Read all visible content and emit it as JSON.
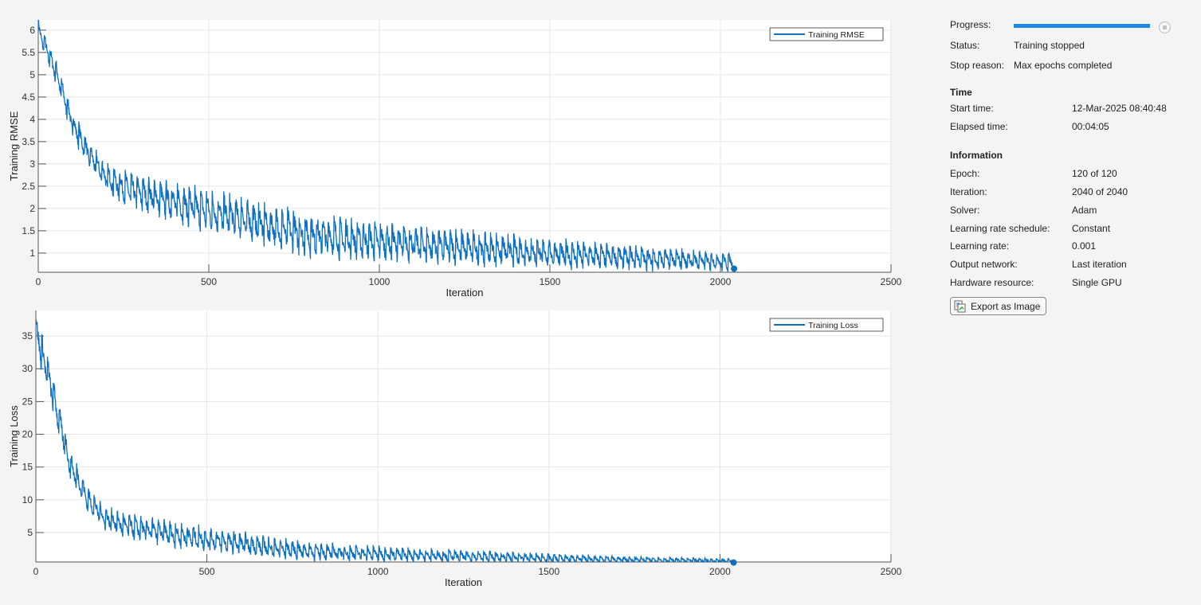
{
  "chart_data": [
    {
      "type": "line",
      "title": "",
      "xlabel": "Iteration",
      "ylabel": "Training RMSE",
      "xlim": [
        0,
        2500
      ],
      "ylim": [
        0.57,
        6.23
      ],
      "xticks": [
        0,
        500,
        1000,
        1500,
        2000,
        2500
      ],
      "yticks": [
        1,
        1.5,
        2,
        2.5,
        3,
        3.5,
        4,
        4.5,
        5,
        5.5,
        6
      ],
      "grid": true,
      "legend": {
        "position": "top-right",
        "entries": [
          "Training RMSE"
        ]
      },
      "iterations_per_epoch": 17,
      "series": [
        {
          "name": "Training RMSE",
          "color": "#0f6fc0",
          "x": [
            0,
            50,
            100,
            150,
            200,
            250,
            300,
            400,
            500,
            600,
            700,
            800,
            900,
            1000,
            1200,
            1400,
            1600,
            1800,
            2040
          ],
          "upper": [
            6.25,
            5.4,
            4.2,
            3.5,
            3.0,
            2.85,
            2.75,
            2.6,
            2.4,
            2.25,
            2.05,
            1.9,
            1.8,
            1.7,
            1.55,
            1.4,
            1.25,
            1.15,
            1.0
          ],
          "lower": [
            5.8,
            4.9,
            3.7,
            2.95,
            2.45,
            2.2,
            2.05,
            1.8,
            1.6,
            1.4,
            1.2,
            1.05,
            0.98,
            0.95,
            0.85,
            0.78,
            0.72,
            0.68,
            0.65
          ],
          "final": [
            2040,
            0.65
          ]
        }
      ]
    },
    {
      "type": "line",
      "title": "",
      "xlabel": "Iteration",
      "ylabel": "Training Loss",
      "xlim": [
        0,
        2500
      ],
      "ylim": [
        0.5,
        38.9
      ],
      "xticks": [
        0,
        500,
        1000,
        1500,
        2000,
        2500
      ],
      "yticks": [
        5,
        10,
        15,
        20,
        25,
        30,
        35
      ],
      "grid": true,
      "legend": {
        "position": "top-right",
        "entries": [
          "Training Loss"
        ]
      },
      "iterations_per_epoch": 17,
      "series": [
        {
          "name": "Training Loss",
          "color": "#0f6fc0",
          "x": [
            0,
            50,
            100,
            150,
            200,
            250,
            300,
            400,
            500,
            600,
            700,
            800,
            900,
            1000,
            1200,
            1400,
            1600,
            1800,
            2040
          ],
          "upper": [
            39,
            29,
            17.6,
            12.2,
            9,
            8.1,
            7.6,
            6.8,
            5.8,
            5.1,
            4.2,
            3.6,
            3.2,
            2.9,
            2.4,
            2.0,
            1.6,
            1.3,
            1.0
          ],
          "lower": [
            33.6,
            24,
            13.7,
            8.7,
            6,
            4.8,
            4.2,
            3.2,
            2.6,
            2.0,
            1.4,
            1.1,
            0.96,
            0.9,
            0.72,
            0.6,
            0.52,
            0.46,
            0.42
          ],
          "final": [
            2040,
            0.42
          ]
        }
      ]
    }
  ],
  "panel": {
    "progress_label": "Progress:",
    "progress": 1.0,
    "status_label": "Status:",
    "status": "Training stopped",
    "stop_reason_label": "Stop reason:",
    "stop_reason": "Max epochs completed",
    "time_header": "Time",
    "start_time_label": "Start time:",
    "start_time": "12-Mar-2025 08:40:48",
    "elapsed_label": "Elapsed time:",
    "elapsed": "00:04:05",
    "info_header": "Information",
    "epoch_label": "Epoch:",
    "epoch": "120 of 120",
    "iteration_label": "Iteration:",
    "iteration": "2040 of 2040",
    "solver_label": "Solver:",
    "solver": "Adam",
    "lr_schedule_label": "Learning rate schedule:",
    "lr_schedule": "Constant",
    "lr_label": "Learning rate:",
    "lr": "0.001",
    "output_label": "Output network:",
    "output": "Last iteration",
    "hardware_label": "Hardware resource:",
    "hardware": "Single GPU",
    "export_label": "Export as Image"
  }
}
